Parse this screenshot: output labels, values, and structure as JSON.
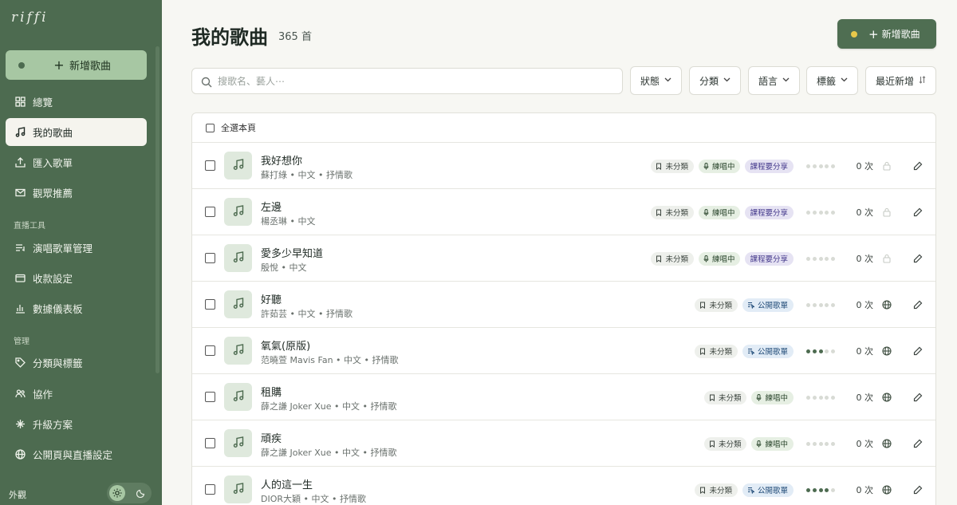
{
  "sidebar": {
    "logo": "riffi",
    "add_label": "新增歌曲",
    "nav": [
      {
        "label": "總覽",
        "icon": "grid-icon"
      },
      {
        "label": "我的歌曲",
        "icon": "music-note-icon",
        "active": true
      },
      {
        "label": "匯入歌單",
        "icon": "import-icon"
      },
      {
        "label": "觀眾推薦",
        "icon": "mail-icon"
      }
    ],
    "section_live": "直播工具",
    "nav_live": [
      {
        "label": "演唱歌單管理",
        "icon": "playlist-icon"
      },
      {
        "label": "收款設定",
        "icon": "wallet-icon"
      },
      {
        "label": "數據儀表板",
        "icon": "bar-chart-icon"
      }
    ],
    "section_manage": "管理",
    "nav_manage": [
      {
        "label": "分類與標籤",
        "icon": "tag-icon"
      },
      {
        "label": "協作",
        "icon": "users-icon"
      },
      {
        "label": "升級方案",
        "icon": "sparkle-icon"
      },
      {
        "label": "公開頁與直播設定",
        "icon": "globe-icon"
      }
    ],
    "appearance_label": "外觀"
  },
  "header": {
    "title": "我的歌曲",
    "count": "365 首",
    "add_label": "新增歌曲"
  },
  "toolbar": {
    "search_placeholder": "搜歌名、藝人⋯",
    "filters": [
      "狀態",
      "分類",
      "語言",
      "標籤"
    ],
    "sort_label": "最近新增"
  },
  "list": {
    "select_all_label": "全選本頁",
    "rows": [
      {
        "title": "我好想你",
        "meta": "蘇打綠 • 中文 • 抒情歌",
        "badges": [
          {
            "type": "cat",
            "label": "未分類"
          },
          {
            "type": "prac",
            "label": "練唱中"
          },
          {
            "type": "course",
            "label": "課程要分享"
          }
        ],
        "level": 0,
        "count": "0 次",
        "visibility": "lock"
      },
      {
        "title": "左邊",
        "meta": "楊丞琳 • 中文",
        "badges": [
          {
            "type": "cat",
            "label": "未分類"
          },
          {
            "type": "prac",
            "label": "練唱中"
          },
          {
            "type": "course",
            "label": "課程要分享"
          }
        ],
        "level": 0,
        "count": "0 次",
        "visibility": "lock"
      },
      {
        "title": "愛多少早知道",
        "meta": "殷悅 • 中文",
        "badges": [
          {
            "type": "cat",
            "label": "未分類"
          },
          {
            "type": "prac",
            "label": "練唱中"
          },
          {
            "type": "course",
            "label": "課程要分享"
          }
        ],
        "level": 0,
        "count": "0 次",
        "visibility": "lock"
      },
      {
        "title": "好聽",
        "meta": "許茹芸 • 中文 • 抒情歌",
        "badges": [
          {
            "type": "cat",
            "label": "未分類"
          },
          {
            "type": "public",
            "label": "公開歌單"
          }
        ],
        "level": 0,
        "count": "0 次",
        "visibility": "globe"
      },
      {
        "title": "氧氣(原版)",
        "meta": "范曉萱 Mavis Fan • 中文 • 抒情歌",
        "badges": [
          {
            "type": "cat",
            "label": "未分類"
          },
          {
            "type": "public",
            "label": "公開歌單"
          }
        ],
        "level": 3,
        "count": "0 次",
        "visibility": "globe"
      },
      {
        "title": "租購",
        "meta": "薛之謙 Joker Xue • 中文 • 抒情歌",
        "badges": [
          {
            "type": "cat",
            "label": "未分類"
          },
          {
            "type": "prac",
            "label": "練唱中"
          }
        ],
        "level": 0,
        "count": "0 次",
        "visibility": "globe"
      },
      {
        "title": "頑疾",
        "meta": "薛之謙 Joker Xue • 中文 • 抒情歌",
        "badges": [
          {
            "type": "cat",
            "label": "未分類"
          },
          {
            "type": "prac",
            "label": "練唱中"
          }
        ],
        "level": 0,
        "count": "0 次",
        "visibility": "globe"
      },
      {
        "title": "人的這一生",
        "meta": "DIOR大穎 • 中文 • 抒情歌",
        "badges": [
          {
            "type": "cat",
            "label": "未分類"
          },
          {
            "type": "public",
            "label": "公開歌單"
          }
        ],
        "level": 4,
        "count": "0 次",
        "visibility": "globe"
      }
    ]
  },
  "colors": {
    "sidebar_bg": "#4d6b50",
    "accent": "#4f6e52",
    "accent_light": "#a7c7a3"
  }
}
